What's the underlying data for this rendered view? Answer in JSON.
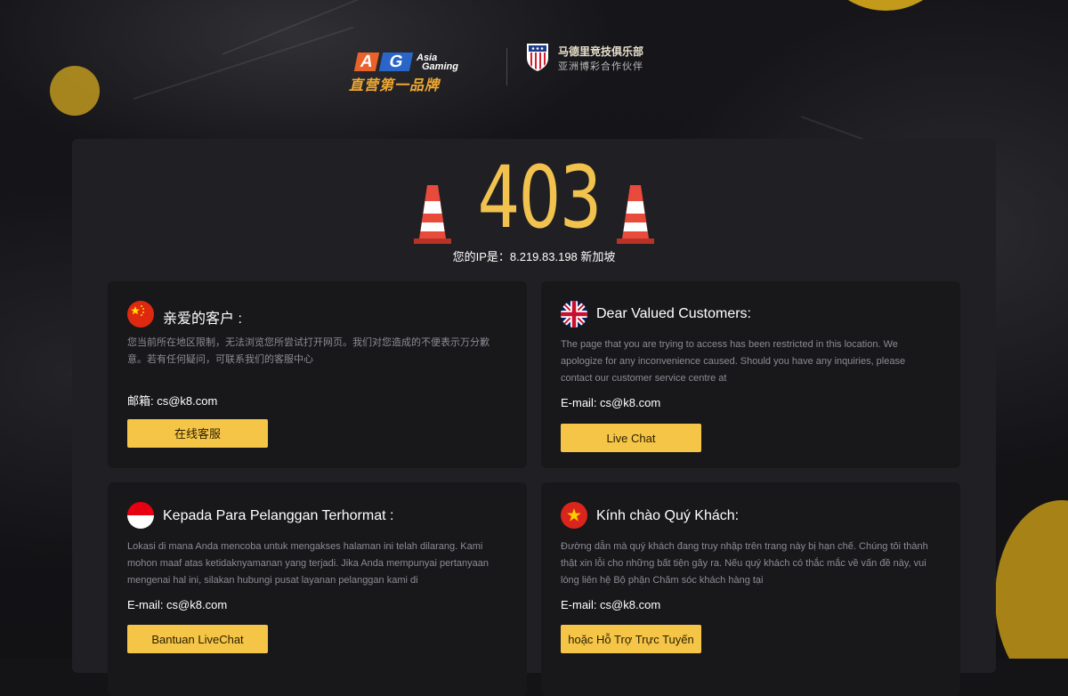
{
  "header": {
    "ag_letters": "AG",
    "ag_asia": "Asia",
    "ag_gaming": "Gaming",
    "ag_slogan": "直营第一品牌",
    "club_name": "马德里竞技俱乐部",
    "club_sub": "亚洲博彩合作伙伴"
  },
  "error": {
    "code": "403",
    "ip_text": "您的IP是：8.219.83.198 新加坡"
  },
  "cards": [
    {
      "flag": "china-flag-icon",
      "title": "亲爱的客户 :",
      "body": "您当前所在地区限制，无法浏览您所尝试打开网页。我们对您造成的不便表示万分歉意。若有任何疑问，可联系我们的客服中心",
      "email": "邮箱: cs@k8.com",
      "button": "在线客服"
    },
    {
      "flag": "uk-flag-icon",
      "title": "Dear Valued Customers:",
      "body": "The page that you are trying to access has been restricted in this location. We apologize for any inconvenience caused. Should you have any inquiries, please contact our customer service centre at",
      "email": "E-mail: cs@k8.com",
      "button": "Live Chat"
    },
    {
      "flag": "indonesia-flag-icon",
      "title": "Kepada Para Pelanggan Terhormat :",
      "body": "Lokasi di mana Anda mencoba untuk mengakses halaman ini telah dilarang. Kami mohon maaf atas ketidaknyamanan yang terjadi. Jika Anda mempunyai pertanyaan mengenai hal ini, silakan hubungi pusat layanan pelanggan kami di",
      "email": "E-mail: cs@k8.com",
      "button": "Bantuan LiveChat"
    },
    {
      "flag": "vietnam-flag-icon",
      "title": "Kính chào Quý Khách:",
      "body": "Đường dẫn mà quý khách đang truy nhập trên trang này bị hạn chế. Chúng tôi thành thật xin lỗi cho những bất tiện gây ra. Nếu quý khách có thắc mắc về vấn đề này, vui lòng liên hệ Bộ phận Chăm sóc khách hàng tại",
      "email": "E-mail: cs@k8.com",
      "button": "hoặc Hỗ Trợ Trực Tuyến"
    }
  ],
  "colors": {
    "accent": "#f5c548",
    "code": "#f2c24e",
    "panel": "#202024",
    "card": "#18181b"
  }
}
